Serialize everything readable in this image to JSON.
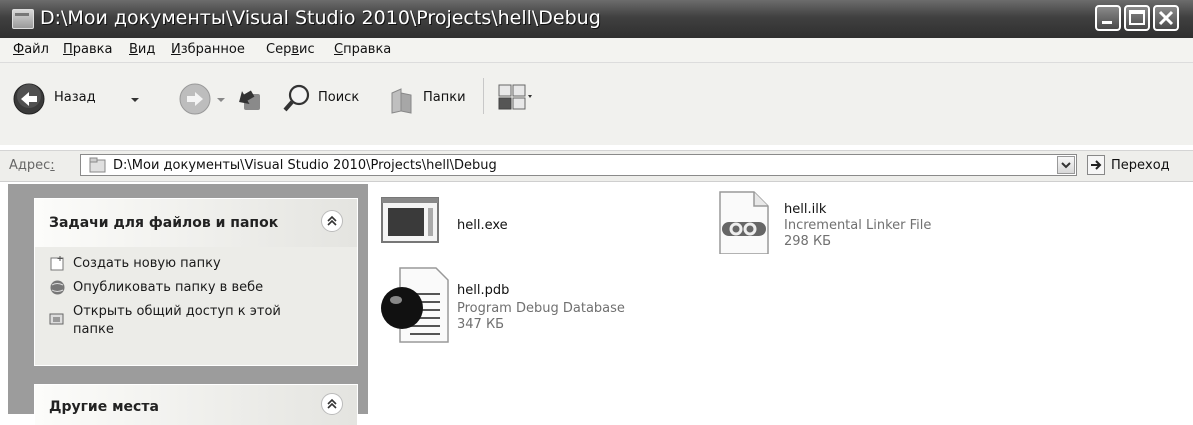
{
  "window": {
    "title": "D:\\Мои документы\\Visual Studio 2010\\Projects\\hell\\Debug"
  },
  "menu": {
    "items": [
      {
        "first": "Ф",
        "rest": "айл"
      },
      {
        "first": "П",
        "rest": "равка"
      },
      {
        "first": "В",
        "rest": "ид"
      },
      {
        "first": "И",
        "rest": "збранное"
      },
      {
        "pre": "Сер",
        "first": "в",
        "rest": "ис"
      },
      {
        "first": "С",
        "rest": "правка"
      }
    ]
  },
  "toolbar": {
    "back_label": "Назад",
    "search_label": "Поиск",
    "folders_label": "Папки"
  },
  "address": {
    "label_main": "Адрес",
    "label_tail": ":",
    "path": "D:\\Мои документы\\Visual Studio 2010\\Projects\\hell\\Debug",
    "go_label": "Переход"
  },
  "tasks_panel": {
    "title": "Задачи для файлов и папок",
    "items": [
      {
        "label": "Создать новую папку",
        "icon": "new-folder-icon"
      },
      {
        "label": "Опубликовать папку в вебе",
        "icon": "web-publish-icon"
      },
      {
        "label_line1": "Открыть общий доступ к этой",
        "label_line2": "папке",
        "icon": "share-folder-icon"
      }
    ]
  },
  "places_panel": {
    "title": "Другие места"
  },
  "files": [
    {
      "name": "hell.exe",
      "type": "",
      "size": "",
      "icon": "exe-icon"
    },
    {
      "name": "hell.ilk",
      "type": "Incremental Linker File",
      "size": "298 КБ",
      "icon": "linker-file-icon"
    },
    {
      "name": "hell.pdb",
      "type": "Program Debug Database",
      "size": "347 КБ",
      "icon": "debug-database-icon"
    }
  ]
}
